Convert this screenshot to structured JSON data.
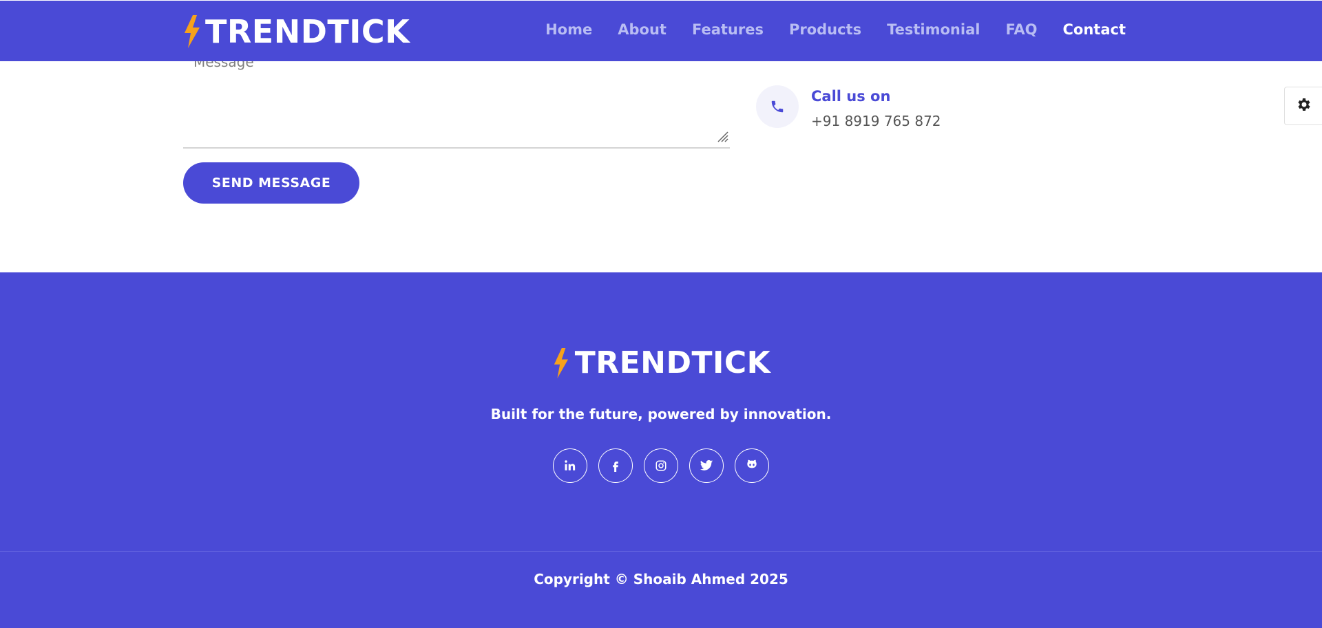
{
  "header": {
    "brand": "TRENDTICK",
    "nav": [
      {
        "label": "Home"
      },
      {
        "label": "About"
      },
      {
        "label": "Features"
      },
      {
        "label": "Products"
      },
      {
        "label": "Testimonial"
      },
      {
        "label": "FAQ"
      },
      {
        "label": "Contact",
        "active": true
      }
    ]
  },
  "form": {
    "message_placeholder": "Message",
    "send_label": "SEND MESSAGE"
  },
  "contact": {
    "call_title": "Call us on",
    "call_number": "+91 8919 765 872",
    "icon": "phone-icon"
  },
  "settings": {
    "icon": "gear-icon"
  },
  "footer": {
    "brand": "TRENDTICK",
    "tagline": "Built for the future, powered by innovation.",
    "socials": [
      "linkedin-icon",
      "facebook-icon",
      "instagram-icon",
      "twitter-icon",
      "github-icon"
    ],
    "copyright": "Copyright © Shoaib Ahmed 2025"
  },
  "colors": {
    "primary": "#4a4ad6",
    "accent": "#f7a21b",
    "nav_inactive": "#b9bdf3",
    "white": "#ffffff"
  }
}
